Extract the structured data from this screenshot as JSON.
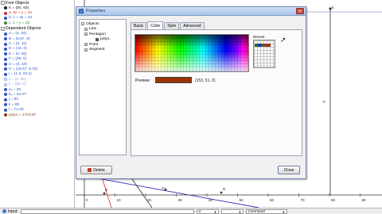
{
  "algebra": {
    "free_header": "Free Objects",
    "free_items": [
      {
        "text": "K = (80, 60)",
        "color": "#202020",
        "hollow": false
      },
      {
        "text": "a: 8x + y = 34",
        "color": "#d43030",
        "hollow": false
      },
      {
        "text": "b: x + 4y = 44",
        "color": "#2f55c8",
        "hollow": false
      },
      {
        "text": "c: x + y = 25",
        "color": "#3a8a3a",
        "hollow": false
      }
    ],
    "dependent_header": "Dependent Objects",
    "dependent_items": [
      {
        "text": "A = (0, 34)",
        "color": "#2f55c8",
        "hollow": false
      },
      {
        "text": "B = (8.67, 0)",
        "color": "#2f55c8",
        "hollow": false
      },
      {
        "text": "C = (0, 11)",
        "color": "#2f55c8",
        "hollow": false
      },
      {
        "text": "D = (44, 0)",
        "color": "#2f55c8",
        "hollow": false
      },
      {
        "text": "E = (0, 25)",
        "color": "#2f55c8",
        "hollow": false
      },
      {
        "text": "F = (25, 0)",
        "color": "#2f55c8",
        "hollow": false
      },
      {
        "text": "G = (4, 10)",
        "color": "#2f55c8",
        "hollow": false
      },
      {
        "text": "H = (18.67, 6.33)",
        "color": "#2f55c8",
        "hollow": false
      },
      {
        "text": "I = (1.3, 23.2)",
        "color": "#2f55c8",
        "hollow": false
      },
      {
        "text": "J = (0, 80)",
        "color": "#8aa0e0",
        "hollow": true
      },
      {
        "text": "L = (80, 0)",
        "color": "#8aa0e0",
        "hollow": true
      },
      {
        "text": "a₁ = 25",
        "color": "#2f55c8",
        "hollow": false
      },
      {
        "text": "b₁ = 34.47",
        "color": "#2f55c8",
        "hollow": false
      },
      {
        "text": "j = 80",
        "color": "#2f55c8",
        "hollow": false
      },
      {
        "text": "k = 80",
        "color": "#2f55c8",
        "hollow": false
      },
      {
        "text": "l = 74.33",
        "color": "#2f55c8",
        "hollow": false
      },
      {
        "text": "poly1 = 4703.67",
        "color": "#8b3a14",
        "hollow": false
      }
    ]
  },
  "dialog": {
    "title": "Properties",
    "objects_header": "Objects",
    "object_tree": [
      {
        "label": "Line",
        "type": "folder",
        "indent": 0
      },
      {
        "label": "Pentagon",
        "type": "folder",
        "indent": 0
      },
      {
        "label": "poly1",
        "type": "leaf",
        "indent": 1
      },
      {
        "label": "Point",
        "type": "folder",
        "indent": 0
      },
      {
        "label": "Segment",
        "type": "folder",
        "indent": 0
      }
    ],
    "tabs": [
      "Basic",
      "Color",
      "Style",
      "Advanced"
    ],
    "active_tab": "Color",
    "recent_label": "Recent",
    "recent_colors": [
      "#1c7a1c",
      "#2a2ab0",
      "#1c7a1c",
      "#b02a2a",
      "#8b3a14"
    ],
    "preview_label": "Preview",
    "preview_color": "#993300",
    "preview_value": "(153, 51, 0)",
    "delete_label": "Delete",
    "close_label": "Close"
  },
  "graph": {
    "x_ticks": [
      "0",
      "10",
      "20",
      "30",
      "40",
      "50",
      "60",
      "70",
      "80",
      "90"
    ],
    "y_axis_label": "0",
    "point_labels": [
      "K",
      "F",
      "D",
      "B"
    ]
  },
  "inputbar": {
    "label": "Input:",
    "combo1": "α",
    "combo2": "",
    "command_label": "Command"
  }
}
